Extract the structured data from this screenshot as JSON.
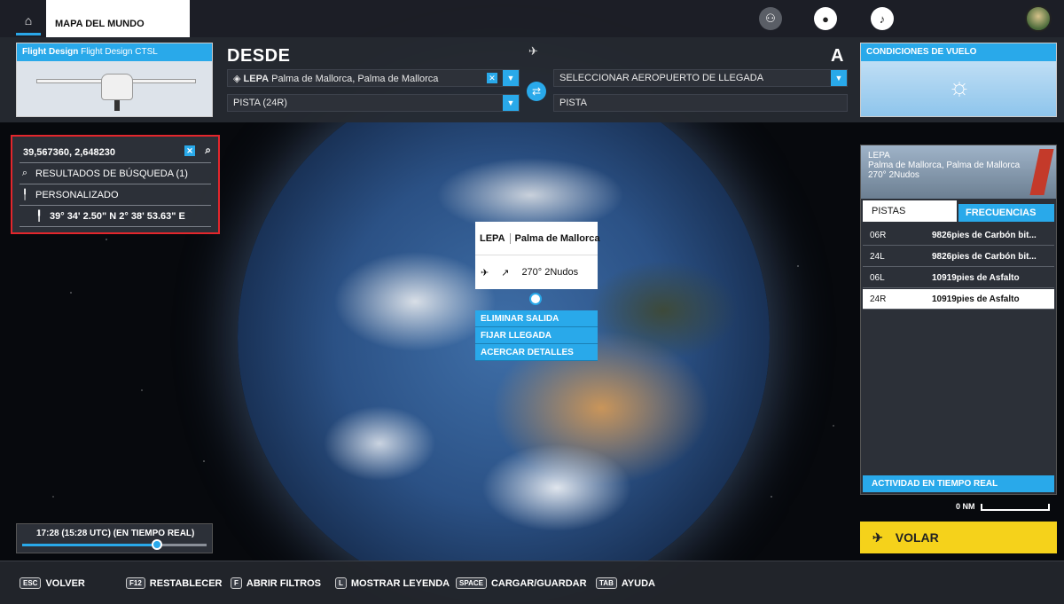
{
  "topbar": {
    "map_tab": "MAPA DEL MUNDO"
  },
  "aircraft": {
    "brand": "Flight Design",
    "model": "Flight Design CTSL"
  },
  "departure": {
    "heading": "DESDE",
    "airport_code": "LEPA",
    "airport_name": "Palma de Mallorca, Palma de Mallorca",
    "runway": "PISTA (24R)"
  },
  "arrival": {
    "heading": "A",
    "airport_placeholder": "SELECCIONAR AEROPUERTO DE LLEGADA",
    "runway": "PISTA"
  },
  "conditions": {
    "title": "CONDICIONES DE VUELO"
  },
  "search": {
    "coords": "39,567360, 2,648230",
    "results": "RESULTADOS DE BÚSQUEDA (1)",
    "custom": "PERSONALIZADO",
    "dms": "39° 34' 2.50\" N 2° 38' 53.63\" E"
  },
  "popup": {
    "code": "LEPA",
    "name": "Palma de Mallorca",
    "wind": "270° 2Nudos"
  },
  "context_menu": [
    "ELIMINAR SALIDA",
    "FIJAR LLEGADA",
    "ACERCAR DETALLES"
  ],
  "airport_panel": {
    "code": "LEPA",
    "name": "Palma de Mallorca, Palma de Mallorca",
    "wind": "270° 2Nudos",
    "tab_runways": "PISTAS",
    "tab_frequencies": "FRECUENCIAS",
    "runways": [
      {
        "id": "06R",
        "desc": "9826pies de Carbón bit..."
      },
      {
        "id": "24L",
        "desc": "9826pies de Carbón bit..."
      },
      {
        "id": "06L",
        "desc": "10919pies de Asfalto"
      },
      {
        "id": "24R",
        "desc": "10919pies de Asfalto"
      }
    ],
    "selected_runway": "24R",
    "activity": "ACTIVIDAD EN TIEMPO REAL"
  },
  "scale": {
    "label": "0 NM"
  },
  "fly_button": "VOLAR",
  "time": {
    "label": "17:28 (15:28 UTC) (EN TIEMPO REAL)",
    "progress": 0.74
  },
  "hints": [
    {
      "key": "ESC",
      "label": "VOLVER"
    },
    {
      "key": "F12",
      "label": "RESTABLECER"
    },
    {
      "key": "F",
      "label": "ABRIR FILTROS"
    },
    {
      "key": "L",
      "label": "MOSTRAR LEYENDA"
    },
    {
      "key": "SPACE",
      "label": "CARGAR/GUARDAR"
    },
    {
      "key": "TAB",
      "label": "AYUDA"
    }
  ],
  "colors": {
    "accent": "#29a9ea",
    "fly": "#f5d21b",
    "highlight": "#e3262c"
  },
  "icons": {
    "home": "home-icon",
    "friends": "group-icon",
    "profile": "user-icon",
    "notifications": "bell-icon"
  }
}
